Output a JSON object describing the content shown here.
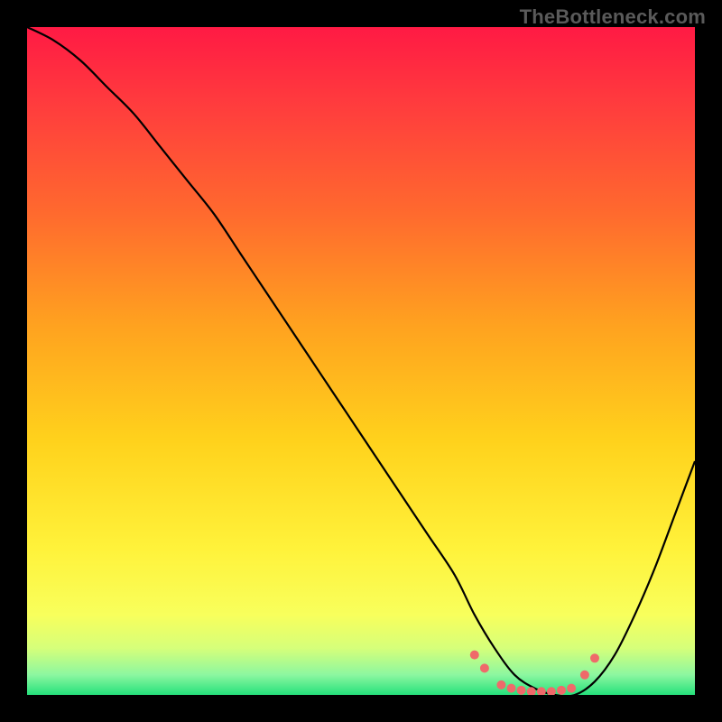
{
  "watermark": "TheBottleneck.com",
  "chart_data": {
    "type": "line",
    "title": "",
    "xlabel": "",
    "ylabel": "",
    "xlim": [
      0,
      100
    ],
    "ylim": [
      0,
      100
    ],
    "background_gradient": {
      "stops": [
        {
          "offset": 0.0,
          "color": "#ff1a44"
        },
        {
          "offset": 0.12,
          "color": "#ff3d3d"
        },
        {
          "offset": 0.28,
          "color": "#ff6a2e"
        },
        {
          "offset": 0.45,
          "color": "#ffa31f"
        },
        {
          "offset": 0.62,
          "color": "#ffd21c"
        },
        {
          "offset": 0.78,
          "color": "#fff23a"
        },
        {
          "offset": 0.88,
          "color": "#f8ff5c"
        },
        {
          "offset": 0.93,
          "color": "#d6ff7a"
        },
        {
          "offset": 0.97,
          "color": "#8cf7a0"
        },
        {
          "offset": 1.0,
          "color": "#25e07b"
        }
      ]
    },
    "series": [
      {
        "name": "bottleneck-curve",
        "color": "#000000",
        "x": [
          0,
          4,
          8,
          12,
          16,
          20,
          24,
          28,
          32,
          36,
          40,
          44,
          48,
          52,
          56,
          60,
          64,
          67,
          70,
          73,
          76,
          79,
          82,
          85,
          88,
          91,
          94,
          97,
          100
        ],
        "y": [
          100,
          98,
          95,
          91,
          87,
          82,
          77,
          72,
          66,
          60,
          54,
          48,
          42,
          36,
          30,
          24,
          18,
          12,
          7,
          3,
          1,
          0,
          0,
          2,
          6,
          12,
          19,
          27,
          35
        ]
      }
    ],
    "markers": {
      "name": "optimal-range-dots",
      "color": "#ef6a6a",
      "radius": 5,
      "points": [
        {
          "x": 67.0,
          "y": 6.0
        },
        {
          "x": 68.5,
          "y": 4.0
        },
        {
          "x": 71.0,
          "y": 1.5
        },
        {
          "x": 72.5,
          "y": 1.0
        },
        {
          "x": 74.0,
          "y": 0.7
        },
        {
          "x": 75.5,
          "y": 0.5
        },
        {
          "x": 77.0,
          "y": 0.5
        },
        {
          "x": 78.5,
          "y": 0.5
        },
        {
          "x": 80.0,
          "y": 0.7
        },
        {
          "x": 81.5,
          "y": 1.0
        },
        {
          "x": 83.5,
          "y": 3.0
        },
        {
          "x": 85.0,
          "y": 5.5
        }
      ]
    }
  }
}
